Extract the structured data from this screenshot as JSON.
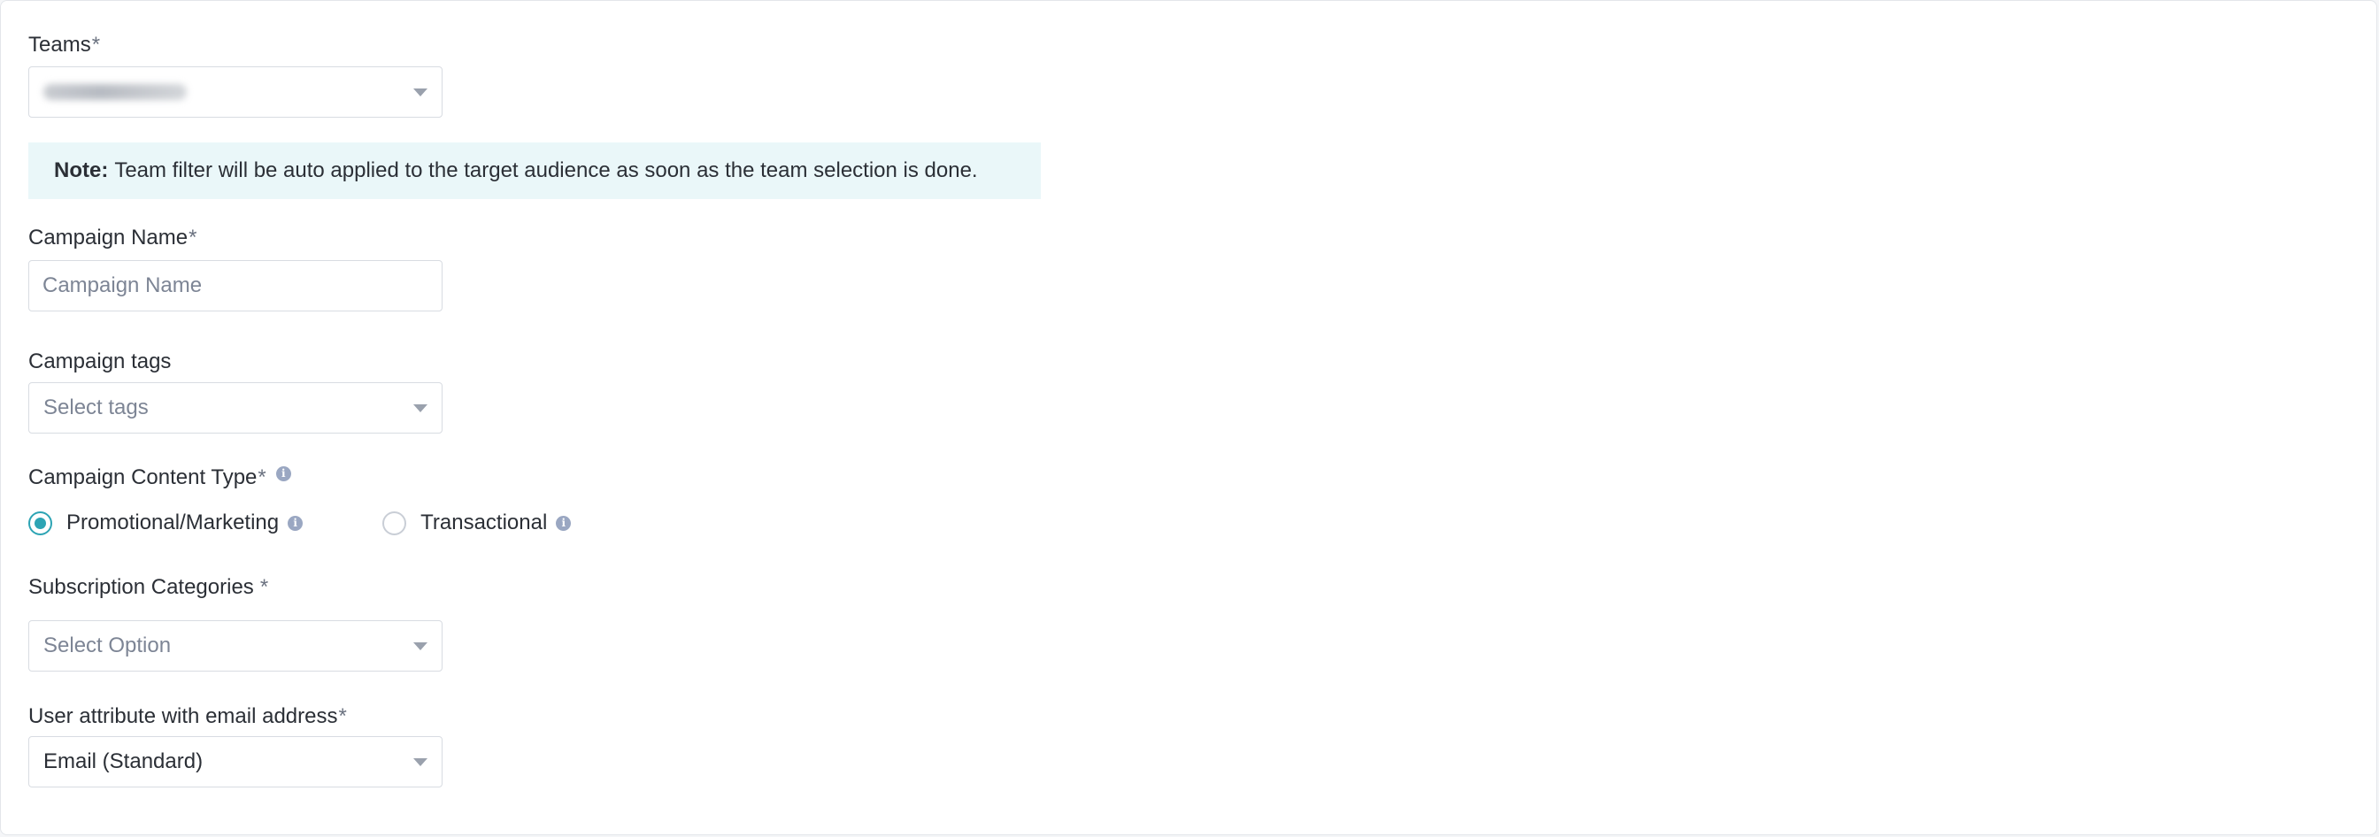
{
  "teams": {
    "label": "Teams",
    "required_mark": "*"
  },
  "note": {
    "prefix": "Note:",
    "text": "Team filter will be auto applied to the target audience as soon as the team selection is done."
  },
  "campaign_name": {
    "label": "Campaign Name",
    "required_mark": "*",
    "placeholder": "Campaign Name",
    "value": ""
  },
  "campaign_tags": {
    "label": "Campaign tags",
    "placeholder": "Select tags"
  },
  "content_type": {
    "label": "Campaign Content Type",
    "required_mark": "*",
    "options": [
      {
        "label": "Promotional/Marketing",
        "selected": true
      },
      {
        "label": "Transactional",
        "selected": false
      }
    ]
  },
  "subscription": {
    "label": "Subscription Categories",
    "required_mark": "*",
    "placeholder": "Select Option"
  },
  "email_attr": {
    "label": "User attribute with email address",
    "required_mark": "*",
    "value": "Email (Standard)"
  },
  "icons": {
    "info": "info-icon",
    "dropdown": "caret-down-icon"
  },
  "colors": {
    "accent": "#2da4b4",
    "note_bg": "#eaf7f9",
    "info_icon": "#9aa7c2",
    "border": "#d8dce2"
  }
}
